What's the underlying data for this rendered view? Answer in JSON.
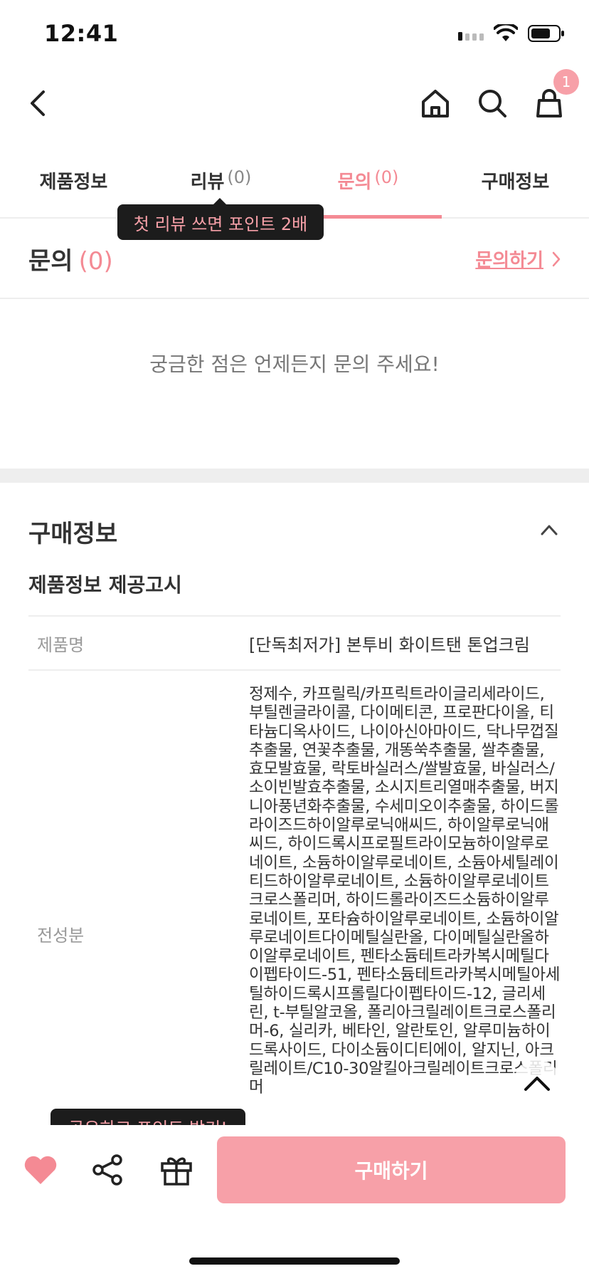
{
  "status": {
    "time": "12:41"
  },
  "header": {
    "cart_badge": "1"
  },
  "tabs": [
    {
      "label": "제품정보",
      "count": ""
    },
    {
      "label": "리뷰",
      "count": "(0)"
    },
    {
      "label": "문의",
      "count": "(0)"
    },
    {
      "label": "구매정보",
      "count": ""
    }
  ],
  "tooltips": {
    "review": "첫 리뷰 쓰면 포인트 2배",
    "share": "공유하고 포인트 받기!"
  },
  "inquiry": {
    "title": "문의",
    "count": "(0)",
    "link": "문의하기",
    "empty_message": "궁금한 점은 언제든지 문의 주세요!"
  },
  "purchase_info": {
    "title": "구매정보",
    "notice_title": "제품정보 제공고시",
    "rows": [
      {
        "label": "제품명",
        "value": "[단독최저가] 본투비 화이트탠 톤업크림"
      },
      {
        "label": "전성분",
        "value": "정제수, 카프릴릭/카프릭트라이글리세라이드, 부틸렌글라이콜, 다이메티콘, 프로판다이올, 티타늄디옥사이드, 나이아신아마이드, 닥나무껍질추출물, 연꽃추출물, 개똥쑥추출물, 쌀추출물, 효모발효물, 락토바실러스/쌀발효물, 바실러스/소이빈발효추출물, 소시지트리열매추출물, 버지니아풍년화추출물, 수세미오이추출물, 하이드롤라이즈드하이알루로닉애씨드, 하이알루로닉애씨드, 하이드록시프로필트라이모늄하이알루로네이트, 소듐하이알루로네이트, 소듐아세틸레이티드하이알루로네이트, 소듐하이알루로네이트크로스폴리머, 하이드롤라이즈드소듐하이알루로네이트, 포타슘하이알루로네이트, 소듐하이알루로네이트다이메틸실란올, 다이메틸실란올하이알루로네이트, 펜타소듐테트라카복시메틸다이펩타이드-51, 펜타소듐테트라카복시메틸아세틸하이드록시프롤릴다이펩타이드-12, 글리세린, t-부틸알코올, 폴리아크릴레이트크로스폴리머-6, 실리카, 베타인, 알란토인, 알루미늄하이드록사이드, 다이소듐이디티에이, 알지닌, 아크릴레이트/C10-30알킬아크릴레이트크로스폴리머"
      }
    ]
  },
  "bottom_bar": {
    "buy_label": "구매하기"
  },
  "colors": {
    "accent": "#f48a94",
    "button": "#f7a0a8",
    "tooltip_bg": "#1c1c1c"
  }
}
